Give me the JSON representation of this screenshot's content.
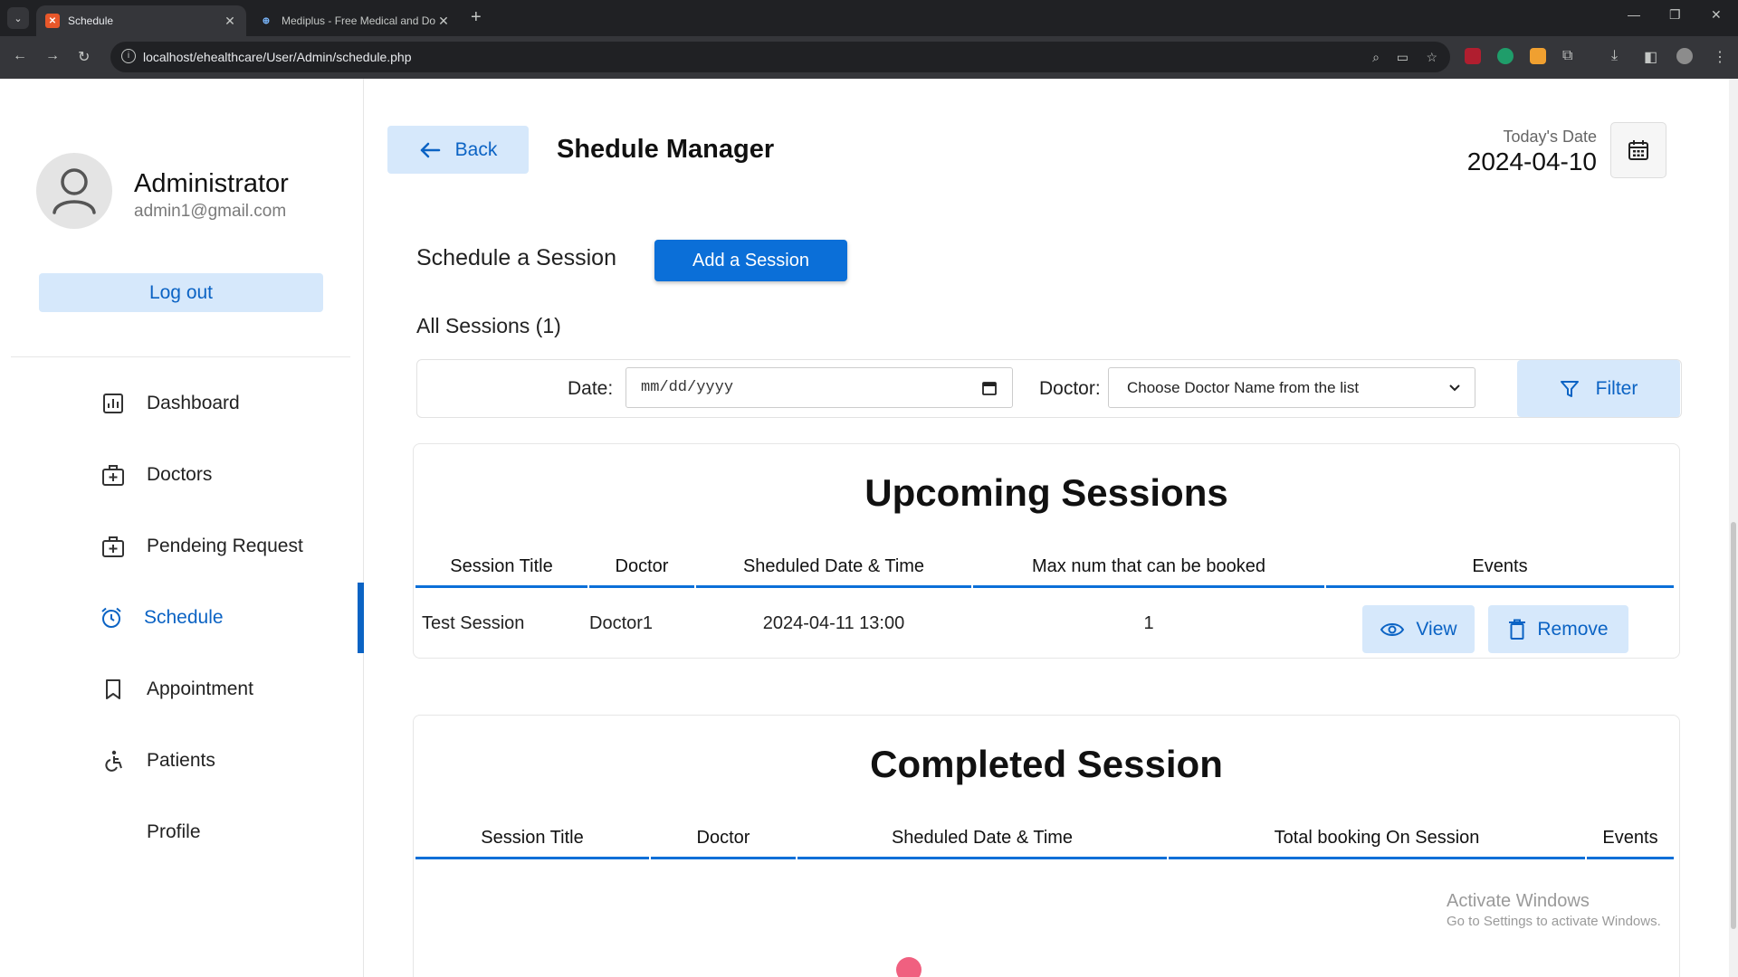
{
  "browser": {
    "tabs": [
      {
        "title": "Schedule",
        "active": true
      },
      {
        "title": "Mediplus - Free Medical and Do",
        "active": false
      }
    ],
    "url": "localhost/ehealthcare/User/Admin/schedule.php"
  },
  "sidebar": {
    "name": "Administrator",
    "email": "admin1@gmail.com",
    "logout": "Log out",
    "items": [
      {
        "label": "Dashboard",
        "icon": "chart-icon"
      },
      {
        "label": "Doctors",
        "icon": "medical-bag-icon"
      },
      {
        "label": "Pendeing Request",
        "icon": "medical-bag-icon"
      },
      {
        "label": "Schedule",
        "icon": "alarm-clock-icon",
        "active": true
      },
      {
        "label": "Appointment",
        "icon": "bookmark-icon"
      },
      {
        "label": "Patients",
        "icon": "wheelchair-icon"
      },
      {
        "label": "Profile",
        "icon": ""
      }
    ]
  },
  "header": {
    "back": "Back",
    "title": "Shedule Manager",
    "today_label": "Today's Date",
    "today_date": "2024-04-10"
  },
  "schedule": {
    "label": "Schedule a Session",
    "add_button": "Add a Session",
    "all_sessions": "All Sessions (1)"
  },
  "filter": {
    "date_label": "Date:",
    "date_placeholder": "mm/dd/yyyy",
    "doctor_label": "Doctor:",
    "doctor_selected": "Choose Doctor Name from the list",
    "button": "Filter"
  },
  "upcoming": {
    "title": "Upcoming Sessions",
    "headers": [
      "Session Title",
      "Doctor",
      "Sheduled Date & Time",
      "Max num that can be booked",
      "Events"
    ],
    "rows": [
      {
        "title": "Test Session",
        "doctor": "Doctor1",
        "datetime": "2024-04-11 13:00",
        "max": "1",
        "view": "View",
        "remove": "Remove"
      }
    ]
  },
  "completed": {
    "title": "Completed Session",
    "headers": [
      "Session Title",
      "Doctor",
      "Sheduled Date & Time",
      "Total booking On Session",
      "Events"
    ]
  },
  "watermark": {
    "title": "Activate Windows",
    "subtitle": "Go to Settings to activate Windows."
  },
  "colors": {
    "accent": "#0b6fd8",
    "light_accent": "#d6e8fb"
  }
}
